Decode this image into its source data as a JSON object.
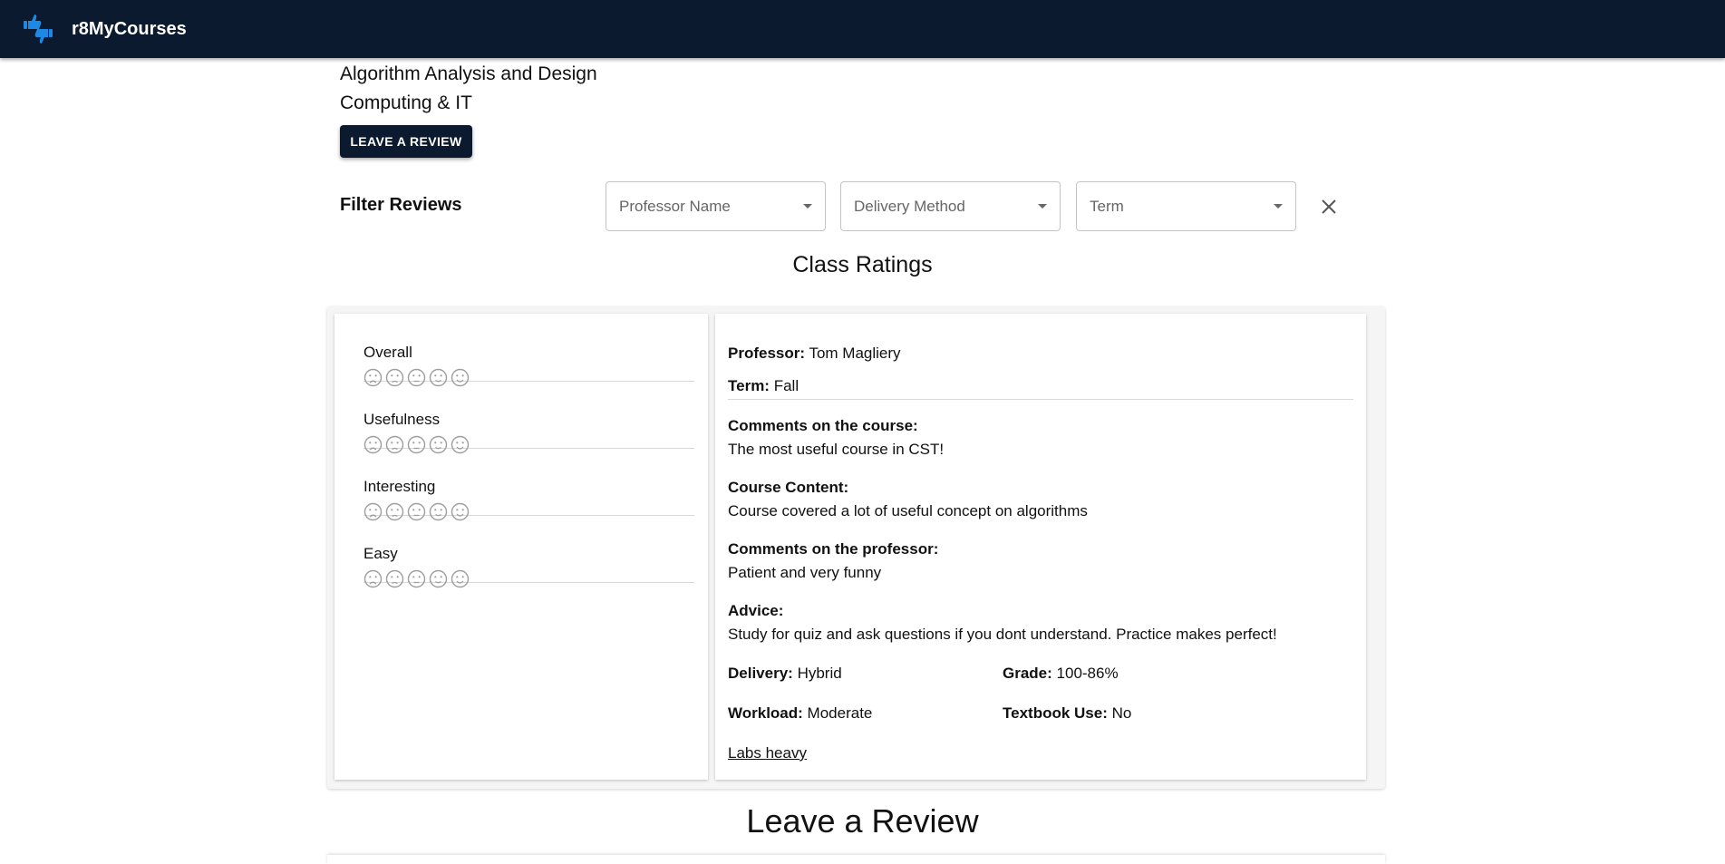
{
  "app": {
    "brand": "r8MyCourses",
    "colors": {
      "appbar": "#0b1a2e",
      "logo": "#1e88e5"
    },
    "logo_icon": "thumbs-up-down-icon"
  },
  "course": {
    "title": "Algorithm Analysis and Design",
    "department": "Computing & IT",
    "leave_review_button": "LEAVE A REVIEW"
  },
  "filters": {
    "label": "Filter Reviews",
    "professor_placeholder": "Professor Name",
    "delivery_placeholder": "Delivery Method",
    "term_placeholder": "Term",
    "clear_icon": "close-icon"
  },
  "class_ratings": {
    "heading": "Class Ratings",
    "categories": [
      {
        "label": "Overall",
        "rating": 0
      },
      {
        "label": "Usefulness",
        "rating": 0
      },
      {
        "label": "Interesting",
        "rating": 0
      },
      {
        "label": "Easy",
        "rating": 0
      }
    ],
    "scale_max": 5,
    "scale_icons": [
      "very-sad-face-icon",
      "sad-face-icon",
      "neutral-face-icon",
      "happy-face-icon",
      "very-happy-face-icon"
    ]
  },
  "review": {
    "professor_label": "Professor:",
    "professor": "Tom Magliery",
    "term_label": "Term:",
    "term": "Fall",
    "comments_course_label": "Comments on the course:",
    "comments_course": "The most useful course in CST!",
    "content_label": "Course Content:",
    "content": "Course covered a lot of useful concept on algorithms",
    "comments_prof_label": "Comments on the professor:",
    "comments_prof": "Patient and very funny",
    "advice_label": "Advice:",
    "advice": "Study for quiz and ask questions if you dont understand. Practice makes perfect!",
    "delivery_label": "Delivery:",
    "delivery": "Hybrid",
    "grade_label": "Grade:",
    "grade": "100-86%",
    "workload_label": "Workload:",
    "workload": "Moderate",
    "textbook_label": "Textbook Use:",
    "textbook": "No",
    "tag": "Labs heavy"
  },
  "leave_review": {
    "heading": "Leave a Review"
  }
}
